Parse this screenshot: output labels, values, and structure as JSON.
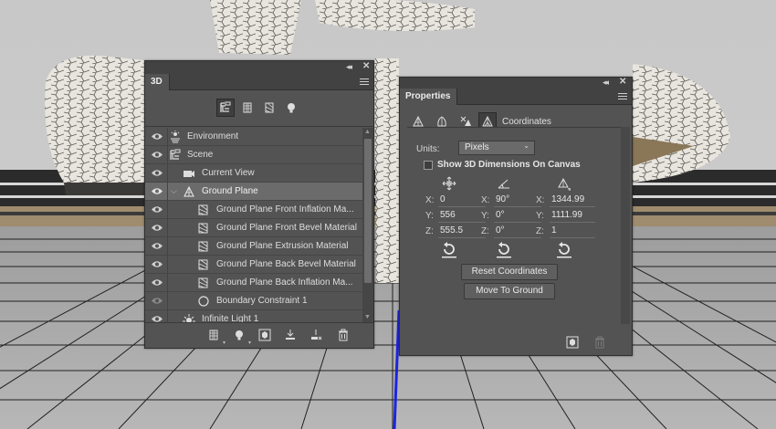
{
  "panel_3d": {
    "tab": "3D",
    "filters": [
      "whole-scene-filter-icon",
      "meshes-filter-icon",
      "materials-filter-icon",
      "lights-filter-icon"
    ],
    "layers": [
      {
        "label": "Environment",
        "icon": "environment-icon",
        "visible": true,
        "depth": 0
      },
      {
        "label": "Scene",
        "icon": "scene-icon",
        "visible": true,
        "depth": 0
      },
      {
        "label": "Current View",
        "icon": "camera-icon",
        "visible": true,
        "depth": 1
      },
      {
        "label": "Ground Plane",
        "icon": "mesh-icon",
        "visible": true,
        "depth": 1,
        "expanded": true,
        "selected": true
      },
      {
        "label": "Ground Plane Front Inflation Ma...",
        "icon": "material-icon",
        "visible": true,
        "depth": 2
      },
      {
        "label": "Ground Plane Front Bevel Material",
        "icon": "material-icon",
        "visible": true,
        "depth": 2
      },
      {
        "label": "Ground Plane Extrusion Material",
        "icon": "material-icon",
        "visible": true,
        "depth": 2
      },
      {
        "label": "Ground Plane Back Bevel Material",
        "icon": "material-icon",
        "visible": true,
        "depth": 2
      },
      {
        "label": "Ground Plane Back Inflation Ma...",
        "icon": "material-icon",
        "visible": true,
        "depth": 2
      },
      {
        "label": "Boundary Constraint 1",
        "icon": "constraint-icon",
        "visible": false,
        "depth": 2
      },
      {
        "label": "Infinite Light 1",
        "icon": "light-icon",
        "visible": true,
        "depth": 1
      }
    ],
    "bottom_actions": [
      "add-mesh-icon",
      "add-light-icon",
      "render-icon",
      "drop-to-ground-icon",
      "new-constraint-icon",
      "trash-icon"
    ]
  },
  "panel_props": {
    "tab": "Properties",
    "modes": [
      "mesh-mode-icon",
      "deform-mode-icon",
      "cap-mode-icon",
      "coordinates-mode-icon"
    ],
    "mode_label": "Coordinates",
    "units_label": "Units:",
    "units_value": "Pixels",
    "show_dims_label": "Show 3D Dimensions On Canvas",
    "columns": {
      "position": {
        "icon": "move-icon",
        "x_label": "X:",
        "x": "0",
        "y_label": "Y:",
        "y": "556",
        "z_label": "Z:",
        "z": "555.5"
      },
      "rotation": {
        "icon": "angle-icon",
        "x_label": "X:",
        "x": "90°",
        "y_label": "Y:",
        "y": "0°",
        "z_label": "Z:",
        "z": "0°"
      },
      "scale": {
        "icon": "scale-icon",
        "x_label": "X:",
        "x": "1344.99",
        "y_label": "Y:",
        "y": "1111.99",
        "z_label": "Z:",
        "z": "1"
      }
    },
    "reset_label": "Reset Coordinates",
    "move_ground_label": "Move To Ground"
  }
}
